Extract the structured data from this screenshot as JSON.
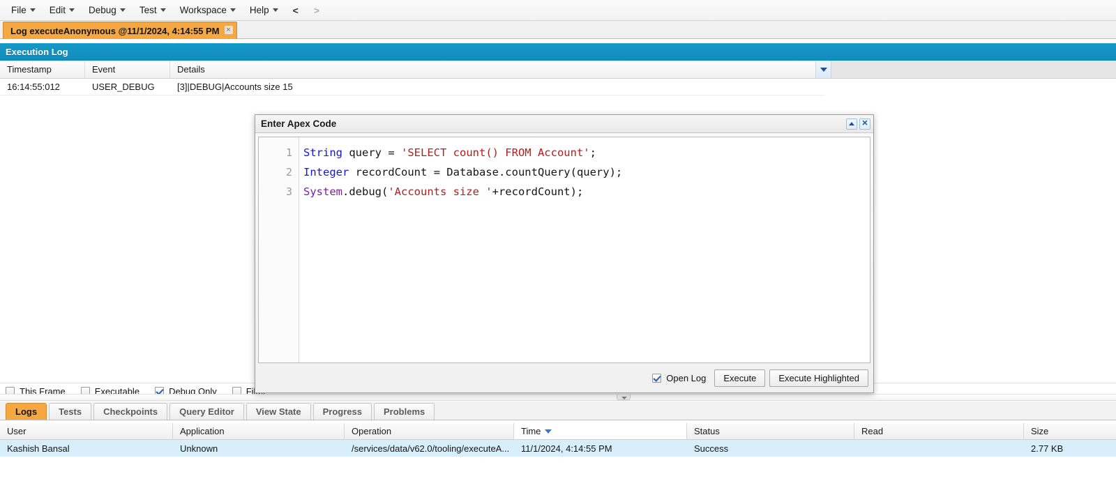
{
  "menubar": {
    "items": [
      {
        "label": "File",
        "caret": true
      },
      {
        "label": "Edit",
        "caret": true
      },
      {
        "label": "Debug",
        "caret": true
      },
      {
        "label": "Test",
        "caret": true
      },
      {
        "label": "Workspace",
        "caret": true
      },
      {
        "label": "Help",
        "caret": true
      }
    ],
    "prev_label": "<",
    "next_label": ">"
  },
  "tabstrip": {
    "document_tab": "Log executeAnonymous @11/1/2024, 4:14:55 PM",
    "close_label": "×"
  },
  "execution_log": {
    "title": "Execution Log",
    "columns": [
      "Timestamp",
      "Event",
      "Details"
    ],
    "rows": [
      {
        "timestamp": "16:14:55:012",
        "event": "USER_DEBUG",
        "details": "[3]|DEBUG|Accounts size 15"
      }
    ]
  },
  "filters": {
    "items": [
      {
        "label": "This Frame",
        "checked": false
      },
      {
        "label": "Executable",
        "checked": false
      },
      {
        "label": "Debug Only",
        "checked": true
      },
      {
        "label": "Filter",
        "checked": false
      }
    ]
  },
  "bottom_tabs": {
    "items": [
      {
        "label": "Logs",
        "active": true
      },
      {
        "label": "Tests",
        "active": false
      },
      {
        "label": "Checkpoints",
        "active": false
      },
      {
        "label": "Query Editor",
        "active": false
      },
      {
        "label": "View State",
        "active": false
      },
      {
        "label": "Progress",
        "active": false
      },
      {
        "label": "Problems",
        "active": false
      }
    ]
  },
  "logs_grid": {
    "columns": [
      {
        "label": "User",
        "sorted": false
      },
      {
        "label": "Application",
        "sorted": false
      },
      {
        "label": "Operation",
        "sorted": false
      },
      {
        "label": "Time",
        "sorted": true
      },
      {
        "label": "Status",
        "sorted": false
      },
      {
        "label": "Read",
        "sorted": false
      },
      {
        "label": "Size",
        "sorted": false
      }
    ],
    "rows": [
      {
        "user": "Kashish Bansal",
        "application": "Unknown",
        "operation": "/services/data/v62.0/tooling/executeA...",
        "time": "11/1/2024, 4:14:55 PM",
        "status": "Success",
        "read": "",
        "size": "2.77 KB"
      }
    ]
  },
  "apex_dialog": {
    "title": "Enter Apex Code",
    "collapse_icon": "collapse-triangle-icon",
    "close_label": "✕",
    "line_numbers": [
      "1",
      "2",
      "3"
    ],
    "code_lines": [
      [
        {
          "t": "String",
          "c": "k"
        },
        {
          "t": " query = ",
          "c": "t"
        },
        {
          "t": "'SELECT count() FROM Account'",
          "c": "s"
        },
        {
          "t": ";",
          "c": "t"
        }
      ],
      [
        {
          "t": "Integer",
          "c": "k"
        },
        {
          "t": " recordCount = Database.countQuery(query);",
          "c": "t"
        }
      ],
      [
        {
          "t": "System",
          "c": "p"
        },
        {
          "t": ".debug(",
          "c": "t"
        },
        {
          "t": "'Accounts size '",
          "c": "s"
        },
        {
          "t": "+recordCount);",
          "c": "t"
        }
      ]
    ],
    "code_plain": [
      "String query = 'SELECT count() FROM Account';",
      "Integer recordCount = Database.countQuery(query);",
      "System.debug('Accounts size '+recordCount);"
    ],
    "open_log_label": "Open Log",
    "open_log_checked": true,
    "execute_label": "Execute",
    "execute_highlighted_label": "Execute Highlighted"
  },
  "colors": {
    "accent_orange": "#f5a742",
    "header_blue": "#1798c7",
    "row_select_blue": "#d9eefb",
    "keyword_blue": "#1616d4",
    "string_red": "#b02020",
    "class_purple": "#7a1fa2"
  }
}
